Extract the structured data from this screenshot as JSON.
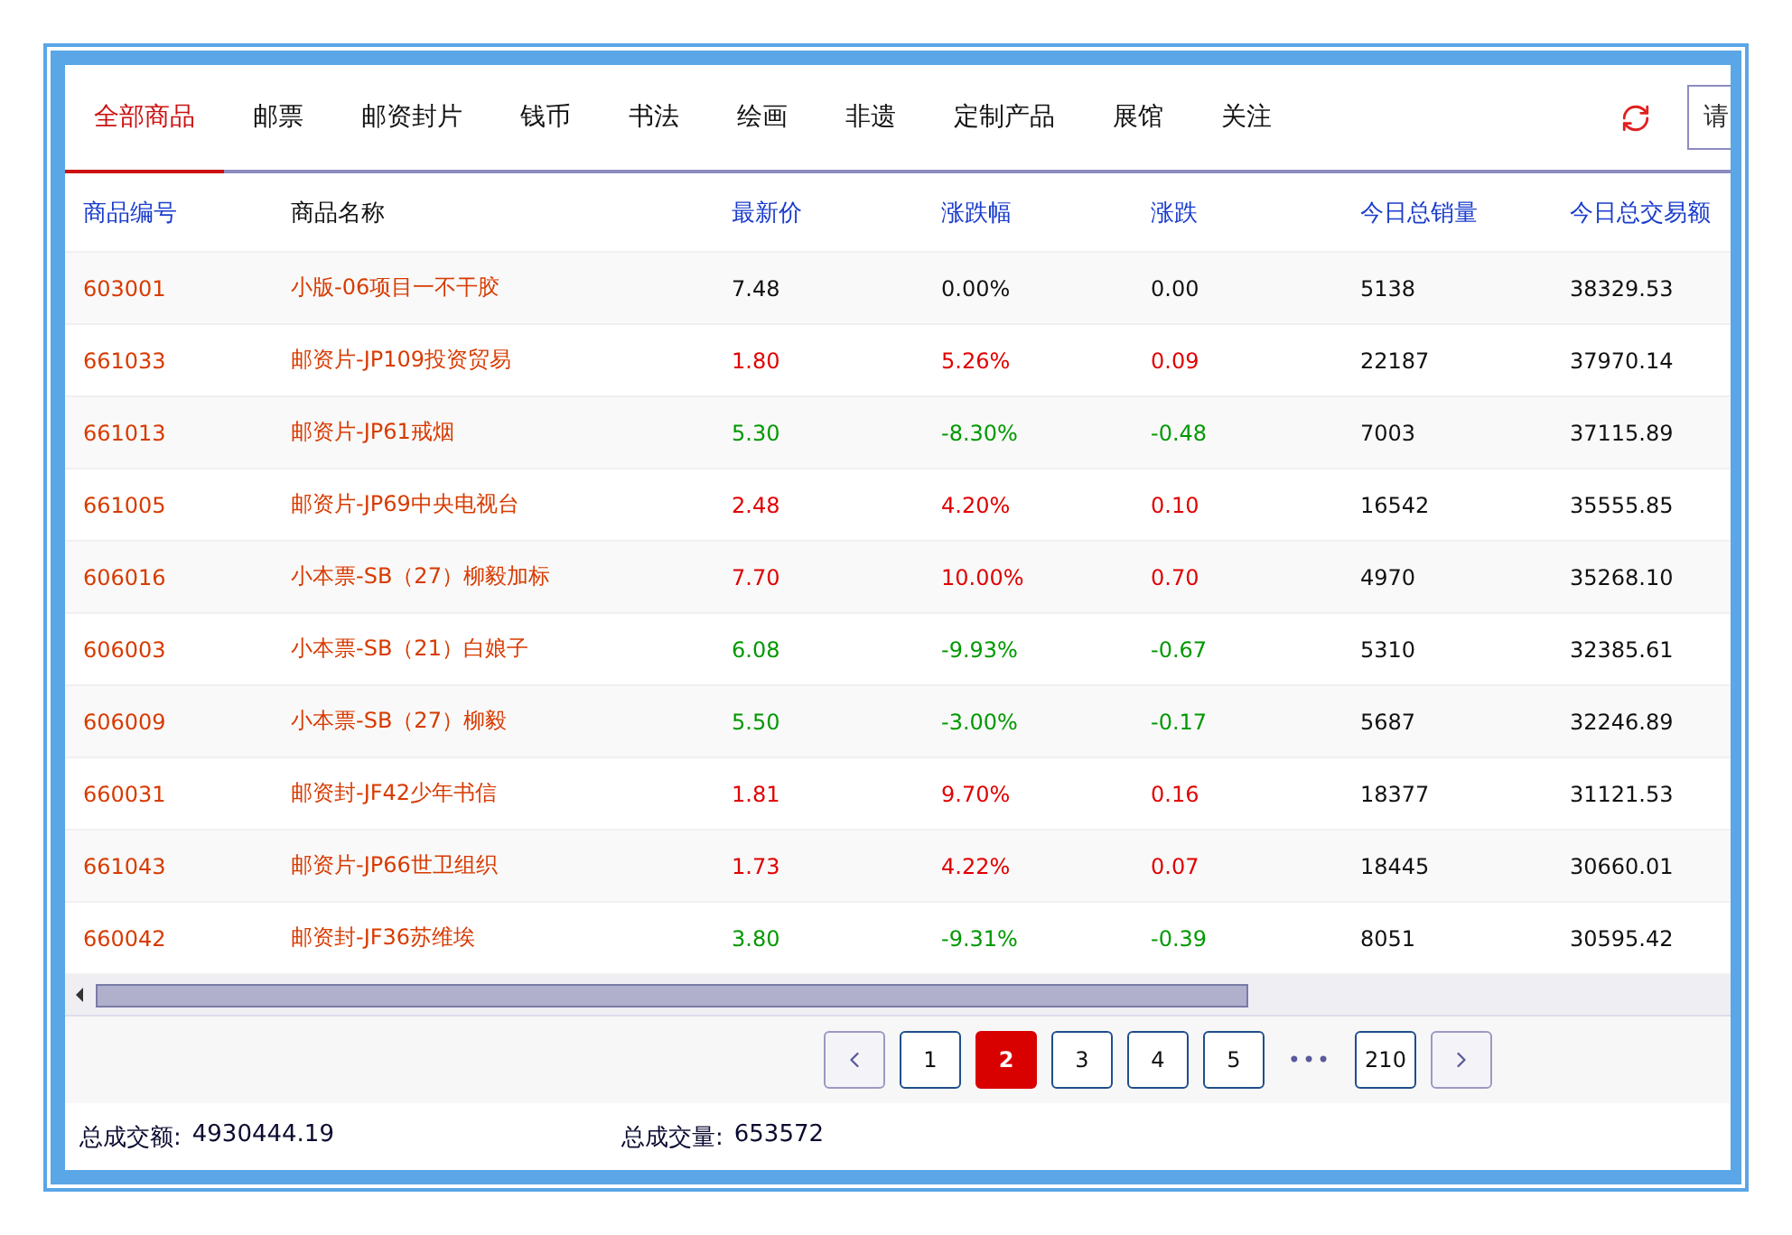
{
  "tabs": [
    {
      "label": "全部商品",
      "selected": true
    },
    {
      "label": "邮票",
      "selected": false
    },
    {
      "label": "邮资封片",
      "selected": false
    },
    {
      "label": "钱币",
      "selected": false
    },
    {
      "label": "书法",
      "selected": false
    },
    {
      "label": "绘画",
      "selected": false
    },
    {
      "label": "非遗",
      "selected": false
    },
    {
      "label": "定制产品",
      "selected": false
    },
    {
      "label": "展馆",
      "selected": false
    },
    {
      "label": "关注",
      "selected": false
    }
  ],
  "search": {
    "placeholder": "请"
  },
  "table": {
    "columns": [
      {
        "label": "商品编号",
        "sortable": true
      },
      {
        "label": "商品名称",
        "sortable": false
      },
      {
        "label": "最新价",
        "sortable": true
      },
      {
        "label": "涨跌幅",
        "sortable": true
      },
      {
        "label": "涨跌",
        "sortable": true
      },
      {
        "label": "今日总销量",
        "sortable": true
      },
      {
        "label": "今日总交易额",
        "sortable": true
      }
    ],
    "rows": [
      {
        "code": "603001",
        "name": "小版-06项目一不干胶",
        "price": "7.48",
        "pct": "0.00%",
        "change": "0.00",
        "volume": "5138",
        "amount": "38329.53",
        "color": "#111111"
      },
      {
        "code": "661033",
        "name": "邮资片-JP109投资贸易",
        "price": "1.80",
        "pct": "5.26%",
        "change": "0.09",
        "volume": "22187",
        "amount": "37970.14",
        "color": "#e00000"
      },
      {
        "code": "661013",
        "name": "邮资片-JP61戒烟",
        "price": "5.30",
        "pct": "-8.30%",
        "change": "-0.48",
        "volume": "7003",
        "amount": "37115.89",
        "color": "#009900"
      },
      {
        "code": "661005",
        "name": "邮资片-JP69中央电视台",
        "price": "2.48",
        "pct": "4.20%",
        "change": "0.10",
        "volume": "16542",
        "amount": "35555.85",
        "color": "#e00000"
      },
      {
        "code": "606016",
        "name": "小本票-SB（27）柳毅加标",
        "price": "7.70",
        "pct": "10.00%",
        "change": "0.70",
        "volume": "4970",
        "amount": "35268.10",
        "color": "#e00000"
      },
      {
        "code": "606003",
        "name": "小本票-SB（21）白娘子",
        "price": "6.08",
        "pct": "-9.93%",
        "change": "-0.67",
        "volume": "5310",
        "amount": "32385.61",
        "color": "#009900"
      },
      {
        "code": "606009",
        "name": "小本票-SB（27）柳毅",
        "price": "5.50",
        "pct": "-3.00%",
        "change": "-0.17",
        "volume": "5687",
        "amount": "32246.89",
        "color": "#009900"
      },
      {
        "code": "660031",
        "name": "邮资封-JF42少年书信",
        "price": "1.81",
        "pct": "9.70%",
        "change": "0.16",
        "volume": "18377",
        "amount": "31121.53",
        "color": "#e00000"
      },
      {
        "code": "661043",
        "name": "邮资片-JP66世卫组织",
        "price": "1.73",
        "pct": "4.22%",
        "change": "0.07",
        "volume": "18445",
        "amount": "30660.01",
        "color": "#e00000"
      },
      {
        "code": "660042",
        "name": "邮资封-JF36苏维埃",
        "price": "3.80",
        "pct": "-9.31%",
        "change": "-0.39",
        "volume": "8051",
        "amount": "30595.42",
        "color": "#009900"
      }
    ]
  },
  "pagination": [
    {
      "kind": "prev"
    },
    {
      "kind": "page",
      "label": "1",
      "selected": false
    },
    {
      "kind": "page",
      "label": "2",
      "selected": true
    },
    {
      "kind": "page",
      "label": "3",
      "selected": false
    },
    {
      "kind": "page",
      "label": "4",
      "selected": false
    },
    {
      "kind": "page",
      "label": "5",
      "selected": false
    },
    {
      "kind": "ellipsis",
      "label": "•••"
    },
    {
      "kind": "page",
      "label": "210",
      "selected": false
    },
    {
      "kind": "next"
    }
  ],
  "footer": [
    {
      "label": "总成交额:",
      "value": "4930444.19"
    },
    {
      "label": "总成交量:",
      "value": "653572"
    }
  ]
}
